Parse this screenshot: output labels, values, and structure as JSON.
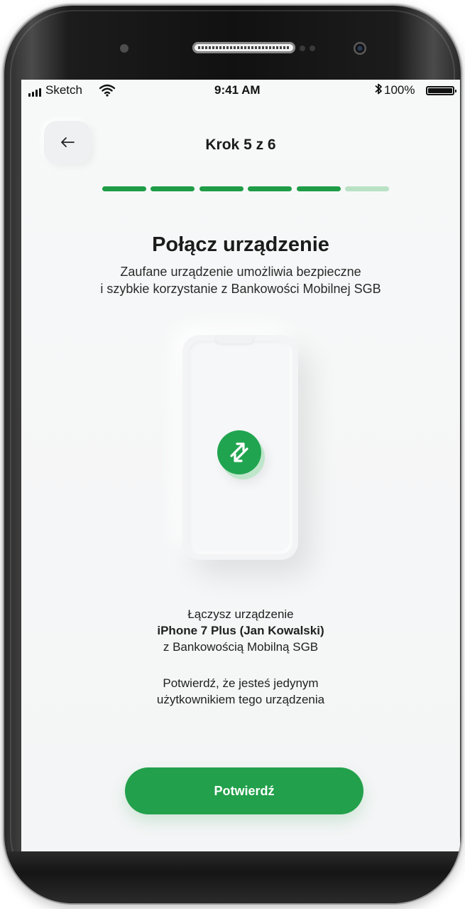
{
  "status_bar": {
    "carrier": "Sketch",
    "time": "9:41 AM",
    "battery": "100%",
    "icons": [
      "signal-icon",
      "wifi-icon",
      "bluetooth-icon",
      "battery-icon"
    ]
  },
  "header": {
    "back_icon": "arrow-left-icon",
    "step_label": "Krok 5 z 6",
    "progress": {
      "current": 5,
      "total": 6
    }
  },
  "main": {
    "title": "Połącz urządzenie",
    "subtitle_lines": [
      "Zaufane urządzenie umożliwia bezpieczne",
      "i szybkie korzystanie z Bankowości Mobilnej SGB"
    ],
    "illustration_icon": "sync-arrows-icon",
    "info": {
      "line1": "Łączysz urządzenie",
      "device": "iPhone 7 Plus (Jan Kowalski)",
      "line3": "z Bankowością Mobilną SGB"
    },
    "confirm_lines": [
      "Potwierdź, że jesteś jedynym",
      "użytkownikiem tego urządzenia"
    ],
    "confirm_button_label": "Potwierdź"
  },
  "colors": {
    "accent": "#22a04b",
    "accent_light": "#b9e2c5",
    "background": "#f5f6f7",
    "text": "#1b1b1b"
  }
}
